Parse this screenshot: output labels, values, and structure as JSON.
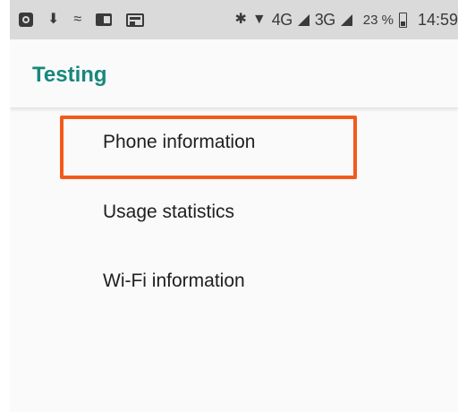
{
  "status_bar": {
    "network_4g": "4G",
    "network_3g": "3G",
    "battery_percent": "23 %",
    "time": "14:59",
    "icons": [
      "sync-icon",
      "usb-icon",
      "swipe-icon",
      "message-icon",
      "widget-icon",
      "bluetooth-icon",
      "wifi-icon",
      "signal-icon",
      "battery-icon"
    ]
  },
  "app_bar": {
    "title": "Testing"
  },
  "menu": {
    "items": [
      {
        "label": "Phone information",
        "highlighted": true
      },
      {
        "label": "Usage statistics"
      },
      {
        "label": "Wi-Fi information"
      }
    ]
  },
  "colors": {
    "accent": "#18877c",
    "highlight_border": "#f25a1d",
    "status_bar": "#dadada"
  }
}
